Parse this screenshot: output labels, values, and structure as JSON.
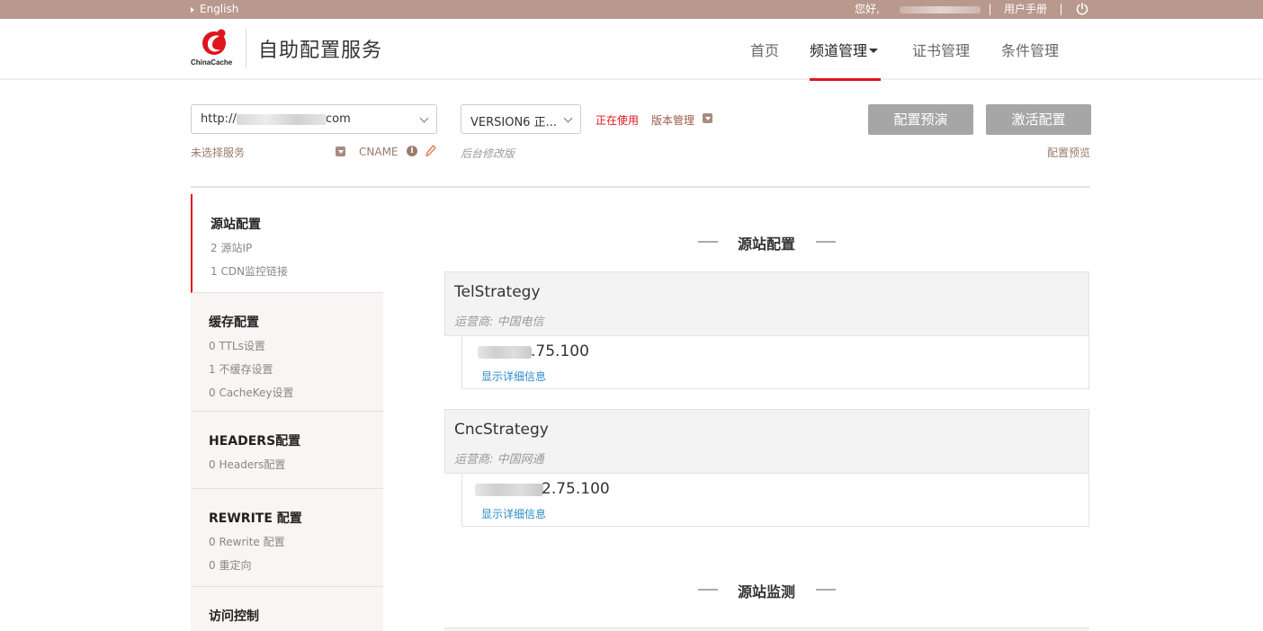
{
  "topbar": {
    "language": "English",
    "greeting": "您好,",
    "manual": "用户手册"
  },
  "header": {
    "logo_text": "ChinaCache",
    "app_title": "自助配置服务",
    "nav": [
      "首页",
      "频道管理",
      "证书管理",
      "条件管理"
    ],
    "active_nav": "频道管理"
  },
  "service": {
    "selected": "http://",
    "selected_suffix": "com",
    "hint": "未选择服务",
    "cname_label": "CNAME"
  },
  "version": {
    "selected": "VERSION6 正...",
    "status": "正在使用",
    "manage": "版本管理",
    "note": "后台修改版"
  },
  "actions": {
    "preview": "配置预演",
    "activate": "激活配置",
    "preview_link": "配置预览"
  },
  "sidebar": [
    {
      "title": "源站配置",
      "items": [
        "2 源站IP",
        "1 CDN监控链接"
      ],
      "active": true
    },
    {
      "title": "缓存配置",
      "items": [
        "0 TTLs设置",
        "1 不缓存设置",
        "0 CacheKey设置"
      ]
    },
    {
      "title": "HEADERS配置",
      "items": [
        "0 Headers配置"
      ]
    },
    {
      "title": "REWRITE 配置",
      "items": [
        "0 Rewrite 配置",
        "0 重定向"
      ]
    },
    {
      "title": "访问控制",
      "items": []
    }
  ],
  "main": {
    "section1_title": "源站配置",
    "section2_title": "源站监测",
    "strategies": [
      {
        "name": "TelStrategy",
        "isp": "运营商: 中国电信",
        "ip": ".75.100",
        "detail": "显示详细信息"
      },
      {
        "name": "CncStrategy",
        "isp": "运营商: 中国网通",
        "ip": "2.75.100",
        "detail": "显示详细信息"
      }
    ]
  },
  "colors": {
    "topbar": "#b9998d",
    "accent_red": "#e0141e",
    "link_blue": "#2a8bc9",
    "button_gray": "#a6a6a6"
  }
}
